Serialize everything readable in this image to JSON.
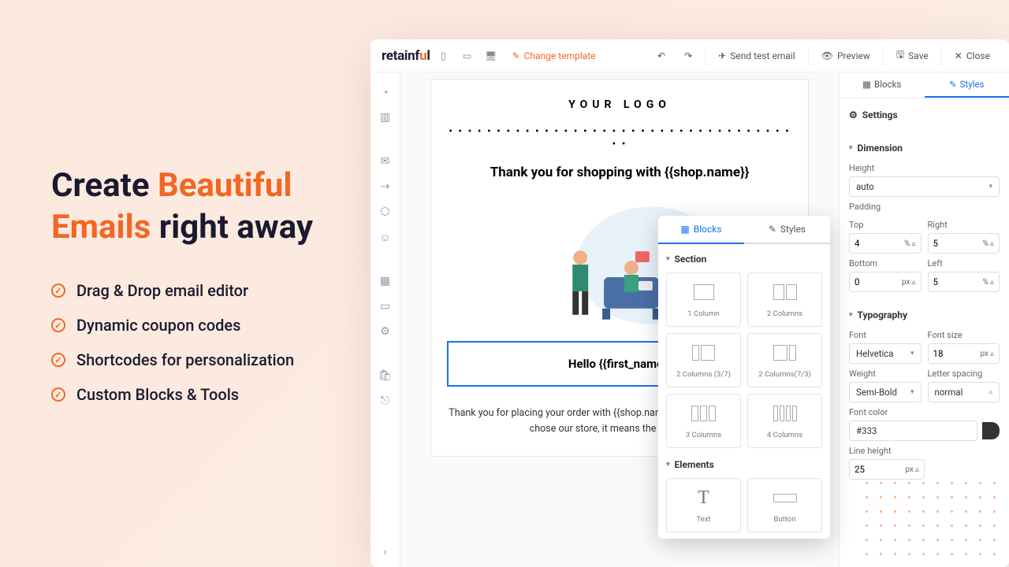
{
  "marketing": {
    "headline_pre": "Create ",
    "headline_accent": "Beautiful Emails",
    "headline_post": " right away",
    "features": [
      "Drag & Drop email editor",
      "Dynamic coupon codes",
      "Shortcodes for personalization",
      "Custom Blocks & Tools"
    ]
  },
  "logo": {
    "pre": "retainf",
    "accent": "u",
    "post": "l"
  },
  "toolbar": {
    "change_template": "Change template",
    "send_test": "Send test email",
    "preview": "Preview",
    "save": "Save",
    "close": "Close"
  },
  "email": {
    "logo_text": "YOUR LOGO",
    "headline": "Thank you for shopping with {{shop.name}}",
    "hello": "Hello {{first_name}}",
    "body": "Thank you for placing your order with {{shop.name}}. We are so happy that you chose our store, it means the world to us."
  },
  "popup": {
    "tab_blocks": "Blocks",
    "tab_styles": "Styles",
    "section_label": "Section",
    "elements_label": "Elements",
    "blocks": {
      "c1": "1 Column",
      "c2": "2 Columns",
      "c37": "2 Columns (3/7)",
      "c73": "2 Columns(7/3)",
      "c3": "3 Columns",
      "c4": "4 Columns"
    },
    "elements": {
      "text": "Text",
      "button": "Button"
    }
  },
  "right": {
    "tab_blocks": "Blocks",
    "tab_styles": "Styles",
    "settings": "Settings",
    "dimension": "Dimension",
    "height_lbl": "Height",
    "height_val": "auto",
    "padding_lbl": "Padding",
    "top": "Top",
    "right": "Right",
    "bottom": "Bottom",
    "left": "Left",
    "pt": "4",
    "pr": "5",
    "pb": "0",
    "pl": "5",
    "pct": "%",
    "px": "px",
    "typography": "Typography",
    "font_lbl": "Font",
    "font_val": "Helvetica",
    "fontsize_lbl": "Font size",
    "fontsize_val": "18",
    "weight_lbl": "Weight",
    "weight_val": "Semi-Bold",
    "ls_lbl": "Letter spacing",
    "ls_val": "normal",
    "color_lbl": "Font color",
    "color_val": "#333",
    "lh_lbl": "Line height",
    "lh_val": "25"
  }
}
